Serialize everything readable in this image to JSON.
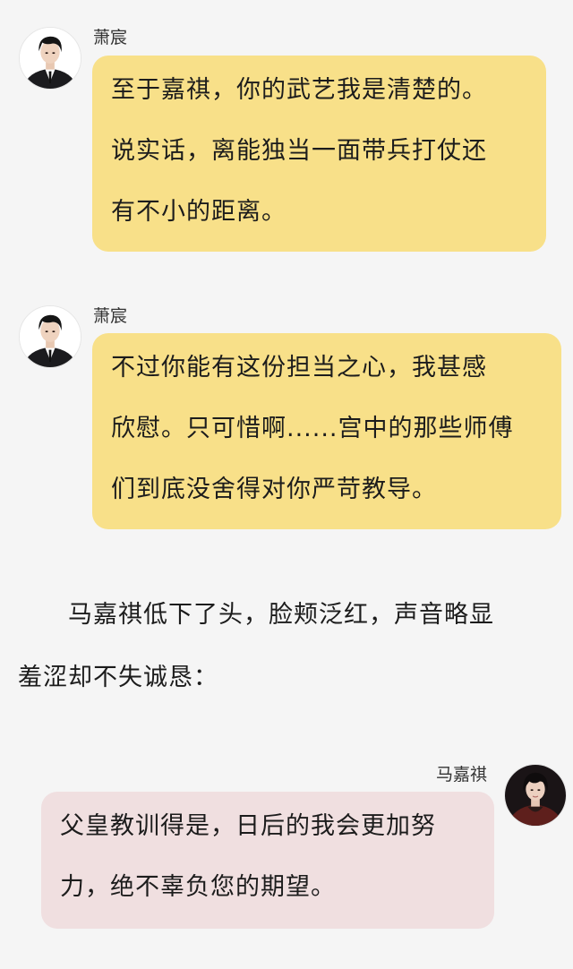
{
  "messages": [
    {
      "sender": "萧宸",
      "avatar_icon": "man-suit-portrait-icon",
      "bubble_color": "#f8e089",
      "lines": [
        "至于嘉祺，你的武艺我是清楚的。",
        "说实话，离能独当一面带兵打仗还",
        "有不小的距离。"
      ]
    },
    {
      "sender": "萧宸",
      "avatar_icon": "man-suit-portrait-icon",
      "bubble_color": "#f8e089",
      "lines": [
        "不过你能有这份担当之心，我甚感",
        "欣慰。只可惜啊......宫中的那些师傅",
        "们到底没舍得对你严苛教导。"
      ]
    }
  ],
  "narration": {
    "lines": [
      "　　马嘉祺低下了头，脸颊泛红，声音略显",
      "羞涩却不失诚恳："
    ]
  },
  "reply": {
    "sender": "马嘉祺",
    "avatar_icon": "young-man-portrait-icon",
    "bubble_color": "#f0dfe0",
    "lines": [
      "父皇教训得是，日后的我会更加努",
      "力，绝不辜负您的期望。"
    ]
  }
}
